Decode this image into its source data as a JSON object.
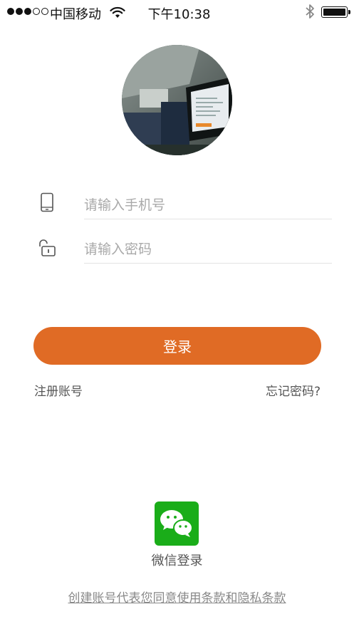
{
  "status_bar": {
    "carrier": "中国移动",
    "time": "下午10:38",
    "signal_strength": 3,
    "signal_max": 5,
    "battery_level": 1.0
  },
  "avatar": {
    "alt": ""
  },
  "form": {
    "phone": {
      "placeholder": "请输入手机号",
      "value": "",
      "icon": "mobile-phone-icon"
    },
    "password": {
      "placeholder": "请输入密码",
      "value": "",
      "icon": "unlock-icon"
    }
  },
  "login_button": "登录",
  "links": {
    "register": "注册账号",
    "forgot_password": "忘记密码?"
  },
  "wechat": {
    "label": "微信登录",
    "icon": "wechat-icon"
  },
  "terms": "创建账号代表您同意使用条款和隐私条款",
  "colors": {
    "accent": "#e06b25",
    "wechat_green": "#1aad19",
    "placeholder": "#a9a9a9",
    "divider": "#e3e3e3"
  }
}
